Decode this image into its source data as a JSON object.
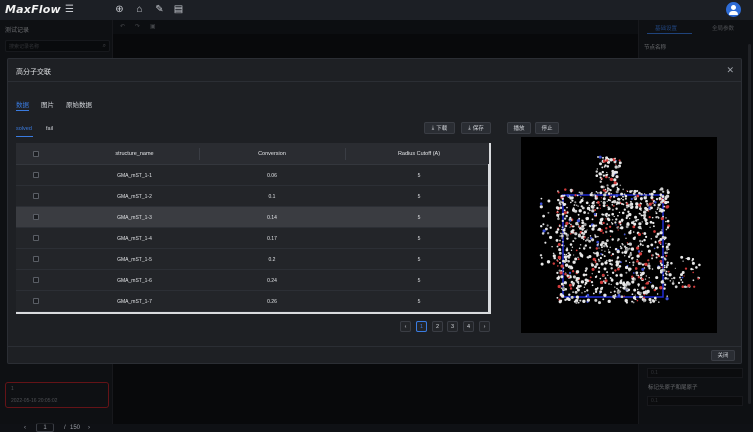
{
  "app": {
    "logo": "MaxFlow"
  },
  "left_panel": {
    "title": "测试记录",
    "search_placeholder": "搜索记录名称",
    "card_index": "1",
    "card_date": "2022-05-16 20:05:02",
    "pager": {
      "prev": "‹",
      "current": "1",
      "separator": "/",
      "total": "150",
      "next": "›"
    }
  },
  "right_panel": {
    "tab_basic": "基础设置",
    "tab_global": "全局参数",
    "label_node_name": "节点名称",
    "field_value": "0.1",
    "label_atom": "标记头原子和尾原子"
  },
  "modal": {
    "title": "高分子交联",
    "close_icon": "✕",
    "tabs": [
      "数据",
      "图片",
      "原始数据"
    ],
    "subtabs": [
      "solved",
      "fail"
    ],
    "download_label": "下载",
    "save_label": "保存",
    "play_label": "播放",
    "stop_label": "停止",
    "footer_close": "关闭"
  },
  "table": {
    "columns": [
      "structure_name",
      "Conversion",
      "Radius Cutoff (A)"
    ],
    "rows": [
      {
        "name": "GMA_mST_1-1",
        "conversion": "0.06",
        "radius": "5"
      },
      {
        "name": "GMA_mST_1-2",
        "conversion": "0.1",
        "radius": "5"
      },
      {
        "name": "GMA_mST_1-3",
        "conversion": "0.14",
        "radius": "5"
      },
      {
        "name": "GMA_mST_1-4",
        "conversion": "0.17",
        "radius": "5"
      },
      {
        "name": "GMA_mST_1-5",
        "conversion": "0.2",
        "radius": "5"
      },
      {
        "name": "GMA_mST_1-6",
        "conversion": "0.24",
        "radius": "5"
      },
      {
        "name": "GMA_mST_1-7",
        "conversion": "0.26",
        "radius": "5"
      }
    ],
    "highlighted_row": 2
  },
  "pagination": {
    "prev": "‹",
    "pages": [
      "1",
      "2",
      "3",
      "4"
    ],
    "active": "1",
    "next": "›"
  },
  "colors": {
    "accent": "#3a7be0",
    "danger": "#b6242a",
    "box": "#1f2ad6"
  }
}
